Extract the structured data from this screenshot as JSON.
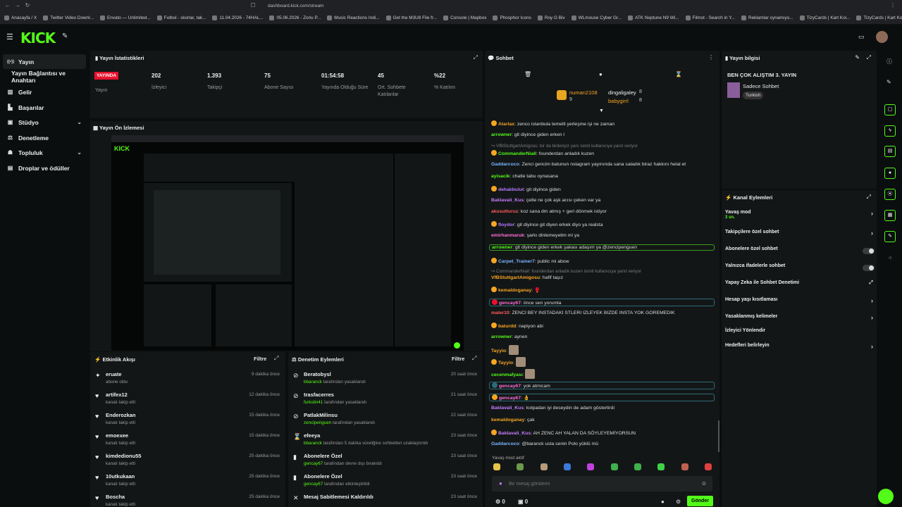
{
  "browser": {
    "url": "dashboard.kick.com/stream",
    "bookmarks": [
      "Anasayfa / X",
      "Twitter Video Downl...",
      "Envato — Unlimited...",
      "Futbol - skorlar, tak...",
      "11.04.2026 - 74HAL...",
      "05.06.2026 - Zoriu P...",
      "Music Reactions Indi...",
      "Get the M3U8 File fr...",
      "Console | Mapbox",
      "Phosphor Icons",
      "Roy G Biv",
      "WLmouse Cyber Gr...",
      "ATK Neptune N9 Wi...",
      "Filmot - Search in Y...",
      "Reklamlar oynamıyo...",
      "TizyCards | Kart Koi...",
      "TizyCards | Kart Koi..."
    ]
  },
  "app": {
    "logo": "KICK"
  },
  "nav": {
    "items": [
      {
        "label": "Yayın",
        "icon": "live-icon"
      },
      {
        "label": "Yayın Bağlantısı ve Anahtarı",
        "icon": ""
      },
      {
        "label": "Gelir",
        "icon": "revenue-icon"
      },
      {
        "label": "Başarılar",
        "icon": "achievements-icon"
      },
      {
        "label": "Stüdyo",
        "icon": "studio-icon"
      },
      {
        "label": "Denetleme",
        "icon": "moderation-icon"
      },
      {
        "label": "Topluluk",
        "icon": "community-icon"
      },
      {
        "label": "Droplar ve ödüller",
        "icon": "drops-icon"
      }
    ]
  },
  "stats": {
    "title": "Yayın İstatistikleri",
    "status_badge": "YAYINDA",
    "status_label": "Yayın",
    "items": [
      {
        "value": "202",
        "label": "İzleyici"
      },
      {
        "value": "1.393",
        "label": "Takipçi"
      },
      {
        "value": "75",
        "label": "Abone Sayısı"
      },
      {
        "value": "01:54:58",
        "label": "Yayında Olduğu Süre"
      },
      {
        "value": "45",
        "label": "Ort. Sohbete Katılanlar"
      },
      {
        "value": "%22",
        "label": "% Katılım"
      }
    ]
  },
  "preview": {
    "title": "Yayın Ön İzlemesi"
  },
  "activity": {
    "title": "Etkinlik Akışı",
    "filter": "Filtre",
    "rows": [
      {
        "name": "eruate",
        "sub": "abone oldu",
        "time": "9 dakika önce",
        "icon": "star-icon"
      },
      {
        "name": "artifex12",
        "sub": "kanalı takip etti",
        "time": "12 dakika önce",
        "icon": "heart-icon"
      },
      {
        "name": "Enderozkan",
        "sub": "kanalı takip etti",
        "time": "15 dakika önce",
        "icon": "heart-icon"
      },
      {
        "name": "emoexee",
        "sub": "kanalı takip etti",
        "time": "15 dakika önce",
        "icon": "heart-icon"
      },
      {
        "name": "kimdedionu55",
        "sub": "kanalı takip etti",
        "time": "25 dakika önce",
        "icon": "heart-icon"
      },
      {
        "name": "10utkukaan",
        "sub": "kanalı takip etti",
        "time": "25 dakika önce",
        "icon": "heart-icon"
      },
      {
        "name": "Boscha",
        "sub": "kanalı takip etti",
        "time": "25 dakika önce",
        "icon": "heart-icon"
      }
    ]
  },
  "moderation": {
    "title": "Denetim Eylemleri",
    "filter": "Filtre",
    "rows": [
      {
        "name": "Beratobysl",
        "actor": "bbaranck",
        "sub": " tarafından yasaklandı",
        "time": "20 saat önce",
        "icon": "ban-icon"
      },
      {
        "name": "trasfacerres",
        "actor": "furkstin41",
        "sub": " tarafından yasaklandı",
        "time": "21 saat önce",
        "icon": "ban-icon"
      },
      {
        "name": "PatlakMilinsu",
        "actor": "zencipenguen",
        "sub": " tarafından yasaklandı",
        "time": "22 saat önce",
        "icon": "ban-icon"
      },
      {
        "name": "efeeya",
        "actor": "bbaranck",
        "sub": " tarafından 5 dakika süreliğine sohbetten uzaklaştırıldı",
        "time": "23 saat önce",
        "icon": "hourglass-icon"
      },
      {
        "name": "Abonelere Özel",
        "actor": "gencay67",
        "sub": " tarafından devre dışı bırakıldı",
        "time": "23 saat önce",
        "icon": "sub-only-icon"
      },
      {
        "name": "Abonelere Özel",
        "actor": "gencay67",
        "sub": " tarafından etkinleştirildi",
        "time": "23 saat önce",
        "icon": "sub-only-icon"
      },
      {
        "name": "Mesaj Sabitlemesi Kaldırıldı",
        "actor": "",
        "sub": "",
        "time": "23 saat önce",
        "icon": "unpin-icon"
      }
    ]
  },
  "chat": {
    "title": "Sohbet",
    "leaders": [
      {
        "name": "numan2108",
        "count": "9"
      },
      {
        "name": "dingaligaley",
        "count": "8"
      },
      {
        "name": "babygirrl",
        "count": "8"
      }
    ],
    "messages": [
      {
        "user": "Atarlax",
        "color": "#f6a623",
        "text": ": zenco istanbula temelli yerleşme işi ne zaman",
        "style": ""
      },
      {
        "user": "arrowner",
        "color": "#53fc18",
        "text": ": git diyince giden erken l",
        "style": ""
      },
      {
        "user": "",
        "color": "",
        "text": "↪ VfBStuttgartAmigosu: bir da birileriyiz yanı isimli kullanıcıya yanıt veriyor",
        "style": "reply"
      },
      {
        "user": "CommanderNiall",
        "color": "#53fc18",
        "text": ": founderdan anladık kuzen",
        "style": ""
      },
      {
        "user": "Gaddarcoco",
        "color": "#7ab6ff",
        "text": ": Zenci gencim batunun nstagram yayınında sana saladık biraz hakkını helal et",
        "style": ""
      },
      {
        "user": "ayisacik",
        "color": "#53fc18",
        "text": ": chatle tabu oynasana",
        "style": ""
      },
      {
        "user": "dehakbulut",
        "color": "#b57bff",
        "text": ": git diyince giden",
        "style": ""
      },
      {
        "user": "Baklavali_Kus",
        "color": "#c77dff",
        "text": ": çetle ne çok aşk acısı çeken var ya",
        "style": ""
      },
      {
        "user": "akusutluruz",
        "color": "#ff5b5b",
        "text": ": koz sana dm atmış + geri dönmek istiyor",
        "style": ""
      },
      {
        "user": "floydor",
        "color": "#b57bff",
        "text": ": git diyince git diyen erkek diyo ya realsta",
        "style": ""
      },
      {
        "user": "emirhanmaruk",
        "color": "#ff6fd8",
        "text": ": şarkı dinlemeyelim mi ya",
        "style": ""
      },
      {
        "user": "arrowner",
        "color": "#53fc18",
        "text": ": git diyince giden erkek şakası adaşım ya @zencipenguen",
        "style": "hl"
      },
      {
        "user": "Carpet_Trainer7",
        "color": "#7ab6ff",
        "text": ": public mi abow",
        "style": ""
      },
      {
        "user": "",
        "color": "",
        "text": "↪ CommanderNiall: founderdan anladık kuzen isimli kullanıcıya yanıt veriyor",
        "style": "reply"
      },
      {
        "user": "VfBStuttgartAmigosu",
        "color": "#f6a623",
        "text": ": hafif taşız",
        "style": ""
      },
      {
        "user": "kemaldoganay",
        "color": "#f6a623",
        "text": ": 🥊",
        "style": ""
      },
      {
        "user": "gencay67",
        "color": "#ff6fd8",
        "text": ": önce sen yorumla",
        "style": "hlb"
      },
      {
        "user": "maler10",
        "color": "#ff5b5b",
        "text": ": ZENCİ BEY İNSTADAKİ STLERİ İZLEYEK BİZDE İNSTA YOK GÖREMEDİK",
        "style": ""
      },
      {
        "user": "baturdd",
        "color": "#f6a623",
        "text": ": napiyon abi",
        "style": ""
      },
      {
        "user": "arrowner",
        "color": "#53fc18",
        "text": ": aynen",
        "style": ""
      },
      {
        "user": "Tayyio",
        "color": "#f6a623",
        "text": ":",
        "style": "emote"
      },
      {
        "user": "Tayyio",
        "color": "#f6a623",
        "text": ":",
        "style": "emote"
      },
      {
        "user": "cecenmafyası",
        "color": "#53fc18",
        "text": ":",
        "style": "emote"
      },
      {
        "user": "gencay67",
        "color": "#ff6fd8",
        "text": ": yok atmicam",
        "style": "hlb"
      },
      {
        "user": "gencay67",
        "color": "#ff6fd8",
        "text": ": 👌",
        "style": "hlb"
      },
      {
        "user": "Baklavali_Kus",
        "color": "#c77dff",
        "text": ": kolpadan iyi deseydin de adam göstertirdi",
        "style": ""
      },
      {
        "user": "kemaldoganay",
        "color": "#f6a623",
        "text": ": çak",
        "style": ""
      },
      {
        "user": "Baklavali_Kus",
        "color": "#c77dff",
        "text": ": AH ZENC AH YALAN DA SÖYLEYEMİYORSUN",
        "style": ""
      },
      {
        "user": "Gaddarcoco",
        "color": "#7ab6ff",
        "text": ": @baranck usta senin Polo yüklü mü",
        "style": ""
      }
    ],
    "slow_mode_notice": "Yavaş mod aktif",
    "input_placeholder": "Bir mesaj gönderin",
    "viewer_count": "0",
    "pin_count": "0",
    "send_label": "Gönder"
  },
  "stream_info": {
    "title": "Yayın bilgisi",
    "stream_title": "BEN ÇOK ALIŞTIM 3. YAYIN",
    "category": "Sadece Sohbet",
    "language": "Turkish"
  },
  "channel_actions": {
    "title": "Kanal Eylemleri",
    "items": [
      {
        "label": "Yavaş mod",
        "sub": "3 sn.",
        "control": "chevron"
      },
      {
        "label": "Takipçilere özel sohbet",
        "sub": "",
        "control": "chevron"
      },
      {
        "label": "Abonelere özel sohbet",
        "sub": "",
        "control": "toggle"
      },
      {
        "label": "Yalnızca ifadelerle sohbet",
        "sub": "",
        "control": "toggle"
      },
      {
        "label": "Yapay Zeka ile Sohbet Denetimi",
        "sub": "",
        "control": "external"
      },
      {
        "label": "Hesap yaşı kısıtlaması",
        "sub": "",
        "control": "chevron"
      },
      {
        "label": "Yasaklanmış kelimeler",
        "sub": "",
        "control": "chevron"
      },
      {
        "label": "İzleyici Yönlendir",
        "sub": "",
        "control": "none"
      },
      {
        "label": "Hedefleri belirleyin",
        "sub": "",
        "control": "chevron"
      }
    ]
  },
  "colors": {
    "brand": "#53fc18",
    "live": "#e8112d",
    "panel": "#131617",
    "bg": "#0b0e0f"
  }
}
